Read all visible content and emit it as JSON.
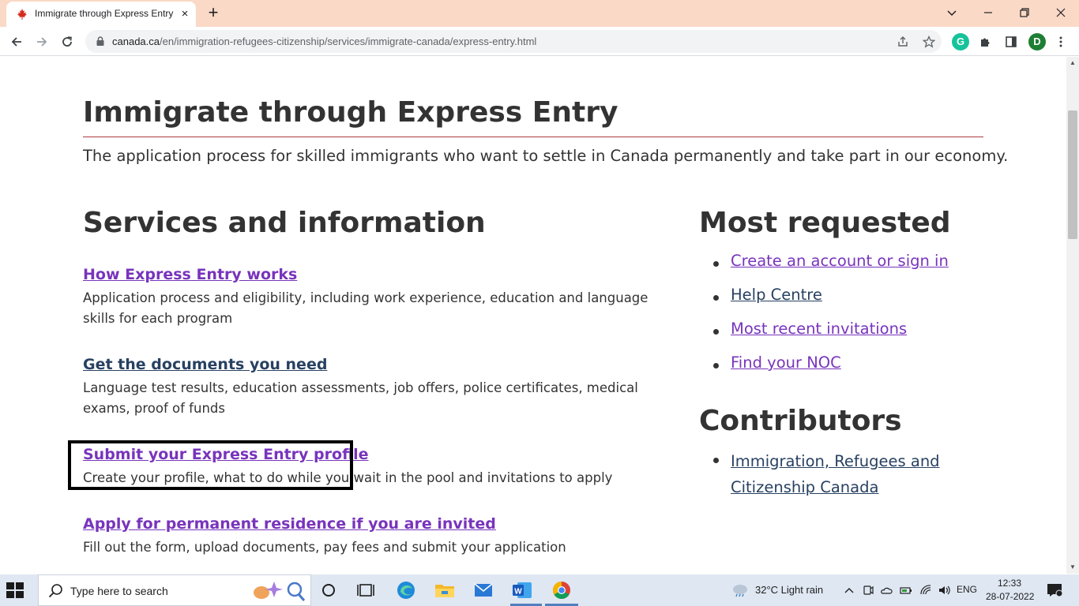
{
  "browser": {
    "tab_title": "Immigrate through Express Entry",
    "tab_close": "×",
    "new_tab": "+",
    "url_host": "canada.ca",
    "url_path": "/en/immigration-refugees-citizenship/services/immigrate-canada/express-entry.html",
    "profile_initial": "D",
    "extension_initial": "G"
  },
  "page": {
    "title": "Immigrate through Express Entry",
    "lead": "The application process for skilled immigrants who want to settle in Canada permanently and take part in our economy.",
    "services_heading": "Services and information",
    "services": [
      {
        "label": "How Express Entry works",
        "desc": "Application process and eligibility, including work experience, education and language skills for each program"
      },
      {
        "label": "Get the documents you need",
        "desc": "Language test results, education assessments, job offers, police certificates, medical exams, proof of funds"
      },
      {
        "label": "Submit your Express Entry profile",
        "desc": "Create your profile, what to do while you wait in the pool and invitations to apply"
      },
      {
        "label": "Apply for permanent residence if you are invited",
        "desc": "Fill out the form, upload documents, pay fees and submit your application"
      }
    ],
    "most_requested_heading": "Most requested",
    "most_requested": [
      "Create an account or sign in",
      "Help Centre",
      "Most recent invitations",
      "Find your NOC"
    ],
    "contributors_heading": "Contributors",
    "contributors": [
      "Immigration, Refugees and Citizenship Canada"
    ]
  },
  "taskbar": {
    "search_placeholder": "Type here to search",
    "weather": "32°C  Light rain",
    "language": "ENG",
    "time": "12:33",
    "date": "28-07-2022"
  },
  "colors": {
    "tabbar_bg": "#fad9c6",
    "visited_link": "#7834bc",
    "link": "#284162",
    "title_rule": "#af3c43"
  }
}
